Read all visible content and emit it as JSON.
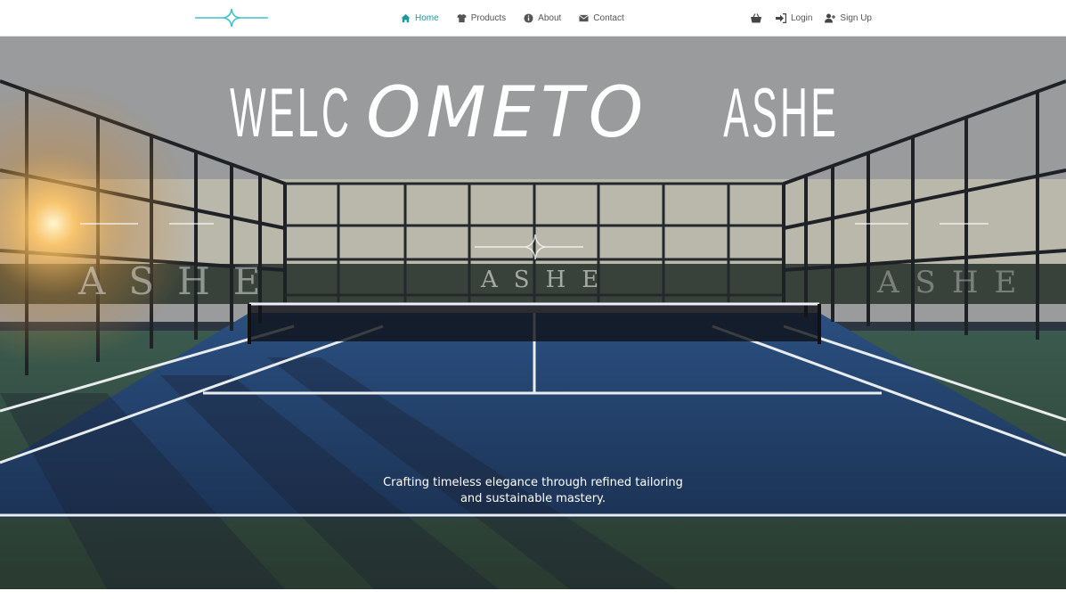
{
  "brand": {
    "logo_icon": "diamond-line-logo",
    "accent_color": "#3fc1c9"
  },
  "nav": {
    "links": [
      {
        "label": "Home",
        "icon": "home-icon",
        "active": true
      },
      {
        "label": "Products",
        "icon": "shirt-icon",
        "active": false
      },
      {
        "label": "About",
        "icon": "info-icon",
        "active": false
      },
      {
        "label": "Contact",
        "icon": "envelope-icon",
        "active": false
      }
    ],
    "cart_icon": "basket-icon",
    "login_label": "Login",
    "signup_label": "Sign Up"
  },
  "hero": {
    "title_parts": [
      "WELC",
      "OME",
      "TO",
      "ASHE"
    ],
    "tagline": "Crafting timeless elegance through refined tailoring and sustainable mastery.",
    "watermark_text": "ASHE",
    "colors": {
      "active_nav": "#1a9a9a",
      "text_white": "#ffffff"
    }
  }
}
